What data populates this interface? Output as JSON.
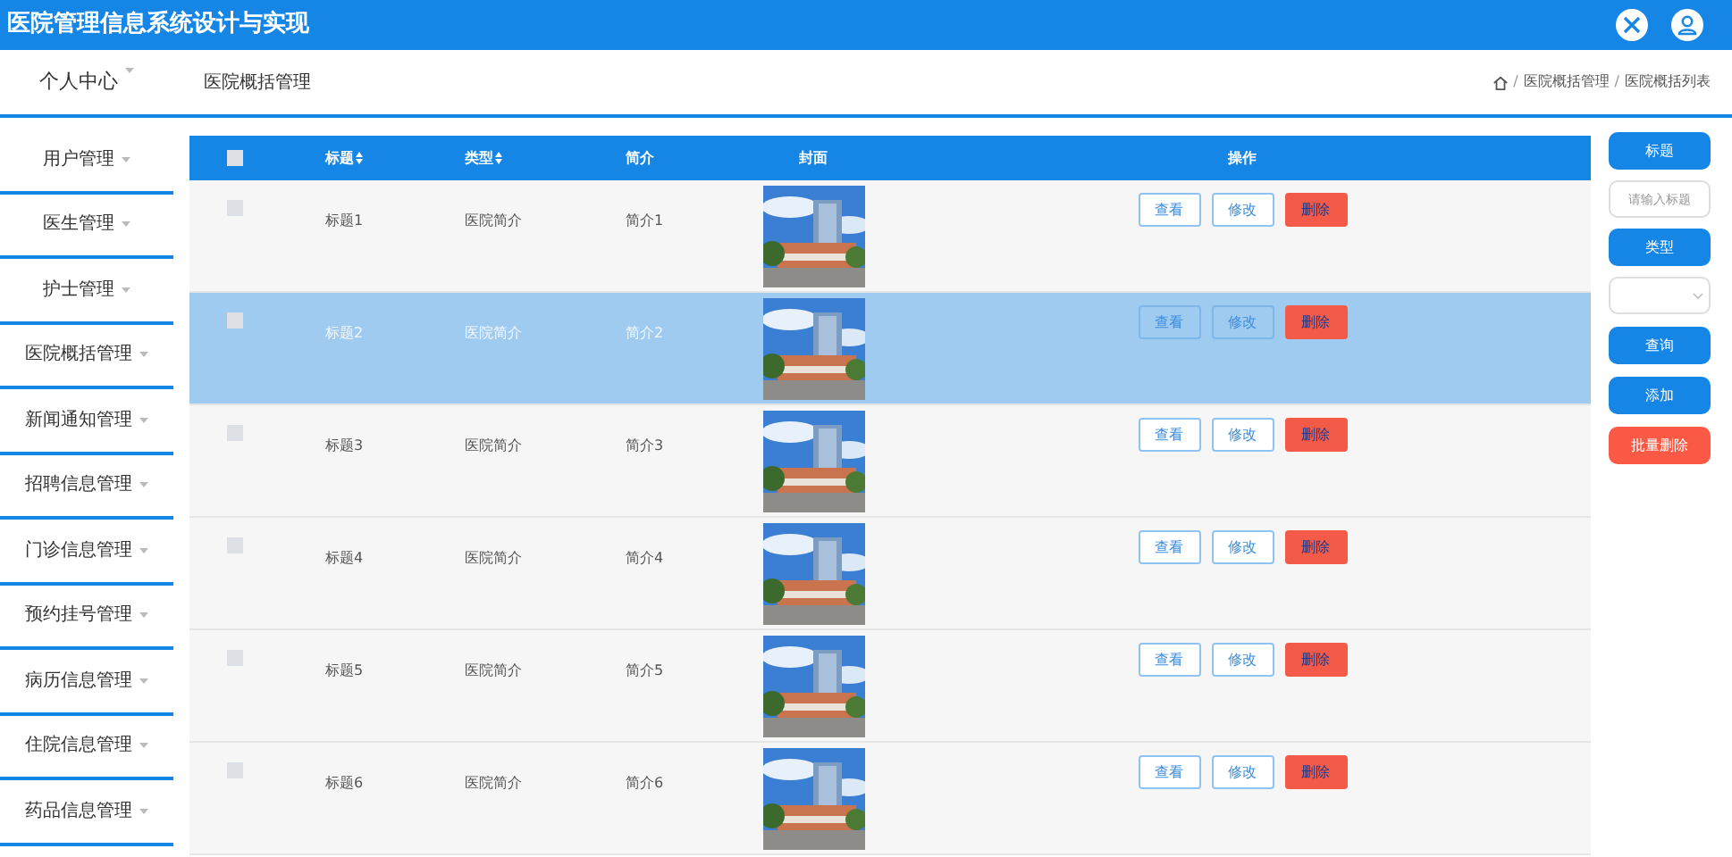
{
  "header": {
    "title": "医院管理信息系统设计与实现"
  },
  "topbar": {
    "menu": "个人中心",
    "page_title": "医院概括管理",
    "breadcrumb": [
      {
        "kind": "separator",
        "text": "/"
      },
      {
        "kind": "link",
        "text": "医院概括管理"
      },
      {
        "kind": "separator",
        "text": "/"
      },
      {
        "kind": "current",
        "text": "医院概括列表"
      }
    ]
  },
  "sidebar": {
    "items": [
      {
        "label": "用户管理"
      },
      {
        "label": "医生管理"
      },
      {
        "label": "护士管理"
      },
      {
        "label": "医院概括管理"
      },
      {
        "label": "新闻通知管理"
      },
      {
        "label": "招聘信息管理"
      },
      {
        "label": "门诊信息管理"
      },
      {
        "label": "预约挂号管理"
      },
      {
        "label": "病历信息管理"
      },
      {
        "label": "住院信息管理"
      },
      {
        "label": "药品信息管理"
      }
    ]
  },
  "table": {
    "columns": [
      {
        "label": "标题",
        "sortable": true
      },
      {
        "label": "类型",
        "sortable": true
      },
      {
        "label": "简介",
        "sortable": false
      },
      {
        "label": "封面",
        "sortable": false
      },
      {
        "label": "操作",
        "sortable": false
      }
    ],
    "select_all_checked": false,
    "rows": [
      {
        "title": "标题1",
        "type": "医院简介",
        "intro": "简介1",
        "selected": false,
        "checked": false,
        "actions": [
          "查看",
          "修改",
          "删除"
        ]
      },
      {
        "title": "标题2",
        "type": "医院简介",
        "intro": "简介2",
        "selected": true,
        "checked": false,
        "actions": [
          "查看",
          "修改",
          "删除"
        ]
      },
      {
        "title": "标题3",
        "type": "医院简介",
        "intro": "简介3",
        "selected": false,
        "checked": false,
        "actions": [
          "查看",
          "修改",
          "删除"
        ]
      },
      {
        "title": "标题4",
        "type": "医院简介",
        "intro": "简介4",
        "selected": false,
        "checked": false,
        "actions": [
          "查看",
          "修改",
          "删除"
        ]
      },
      {
        "title": "标题5",
        "type": "医院简介",
        "intro": "简介5",
        "selected": false,
        "checked": false,
        "actions": [
          "查看",
          "修改",
          "删除"
        ]
      },
      {
        "title": "标题6",
        "type": "医院简介",
        "intro": "简介6",
        "selected": false,
        "checked": false,
        "actions": [
          "查看",
          "修改",
          "删除"
        ]
      }
    ]
  },
  "search_panel": {
    "title_label": "标题",
    "title_placeholder": "请输入标题",
    "type_label": "类型",
    "buttons": [
      {
        "label": "查询",
        "kind": "primary"
      },
      {
        "label": "添加",
        "kind": "primary"
      },
      {
        "label": "批量删除",
        "kind": "danger"
      }
    ]
  }
}
